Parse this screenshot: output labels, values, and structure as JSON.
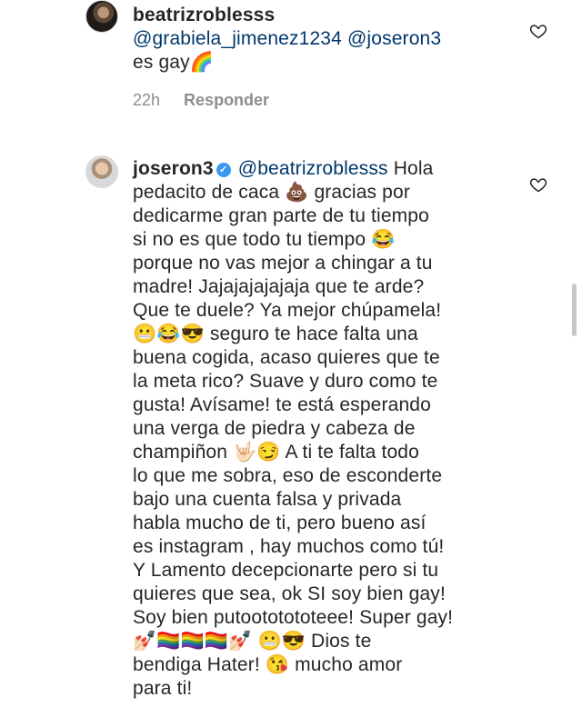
{
  "comments": [
    {
      "username": "beatrizroblesss",
      "mentions": [
        "@grabiela_jimenez1234",
        "@joseron3"
      ],
      "text": "es gay",
      "emoji": "🌈",
      "time": "22h",
      "reply_label": "Responder"
    },
    {
      "username": "joseron3",
      "verified": true,
      "mention": "@beatrizroblesss",
      "lines": [
        "Hola",
        "pedacito de caca 💩 gracias por",
        "dedicarme gran parte de tu tiempo",
        "si no es que todo tu tiempo 😂",
        "porque no vas mejor a chingar a tu",
        "madre! Jajajajajajaja que te arde?",
        "Que te duele? Ya mejor chúpamela!",
        "😬😂😎 seguro te hace falta una",
        "buena cogida, acaso quieres que te",
        "la meta rico? Suave y duro como te",
        "gusta!  Avísame!  te está esperando",
        "una verga de piedra y cabeza de",
        "champiñon 🤟🏻😏 A ti te falta todo",
        "lo que me sobra, eso de esconderte",
        "bajo una cuenta falsa y privada",
        "habla mucho de ti, pero bueno así",
        "es instagram , hay muchos como tú!",
        "Y Lamento decepcionarte pero si tu",
        "quieres que sea, ok SI soy bien gay!",
        "Soy bien putoototototeee! Super gay!",
        "💅🏻🏳️‍🌈🏳️‍🌈🏳️‍🌈💅🏻 😬😎 Dios te",
        "bendiga Hater! 😘 mucho amor",
        "para ti!"
      ]
    }
  ],
  "icons": {
    "like": "heart-outline-icon",
    "verified": "verified-badge-icon"
  },
  "colors": {
    "mention": "#00376b",
    "meta": "#8e8e8e",
    "verified": "#3897f0"
  }
}
